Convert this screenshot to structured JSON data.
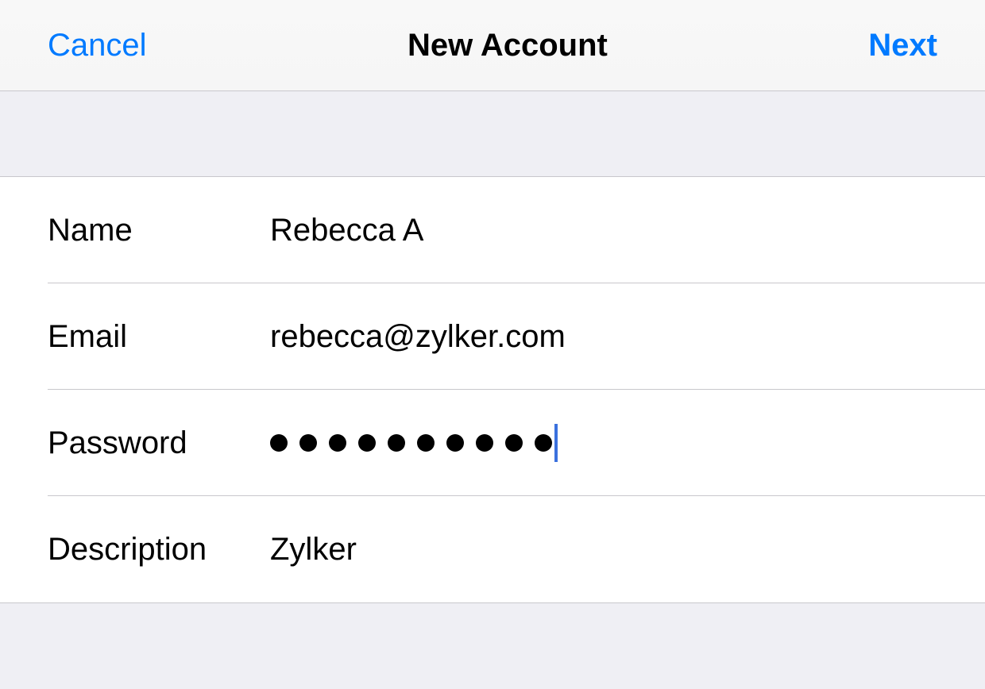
{
  "nav": {
    "cancel_label": "Cancel",
    "title": "New Account",
    "next_label": "Next"
  },
  "form": {
    "name": {
      "label": "Name",
      "value": "Rebecca A"
    },
    "email": {
      "label": "Email",
      "value": "rebecca@zylker.com"
    },
    "password": {
      "label": "Password",
      "dot_count": 10
    },
    "description": {
      "label": "Description",
      "value": "Zylker"
    }
  }
}
